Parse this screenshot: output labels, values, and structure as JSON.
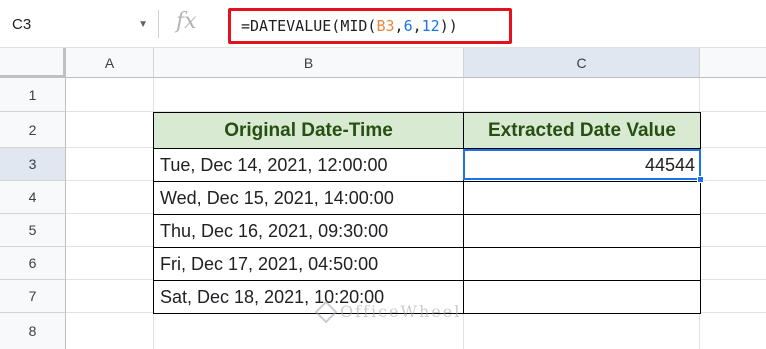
{
  "formula_bar": {
    "name_box": "C3",
    "fx_label": "fx",
    "formula_prefix": "=DATEVALUE(MID(",
    "formula_ref": "B3",
    "formula_sep1": ",",
    "formula_arg2": "6",
    "formula_sep2": ",",
    "formula_arg3": "12",
    "formula_suffix": "))"
  },
  "columns": [
    "A",
    "B",
    "C"
  ],
  "rows": [
    "1",
    "2",
    "3",
    "4",
    "5",
    "6",
    "7",
    "8"
  ],
  "table": {
    "headers": [
      "Original Date-Time",
      "Extracted Date Value"
    ],
    "rows": [
      {
        "original": "Tue, Dec 14, 2021, 12:00:00",
        "extracted": "44544"
      },
      {
        "original": "Wed, Dec 15, 2021, 14:00:00",
        "extracted": ""
      },
      {
        "original": "Thu, Dec 16, 2021, 09:30:00",
        "extracted": ""
      },
      {
        "original": "Fri, Dec 17, 2021, 04:50:00",
        "extracted": ""
      },
      {
        "original": "Sat, Dec 18, 2021, 10:20:00",
        "extracted": ""
      }
    ]
  },
  "watermark": "OfficeWheel",
  "colors": {
    "header_fill": "#d9ead3",
    "header_text": "#274e13",
    "formula_highlight": "#e5101f",
    "selection": "#1a73e8"
  }
}
